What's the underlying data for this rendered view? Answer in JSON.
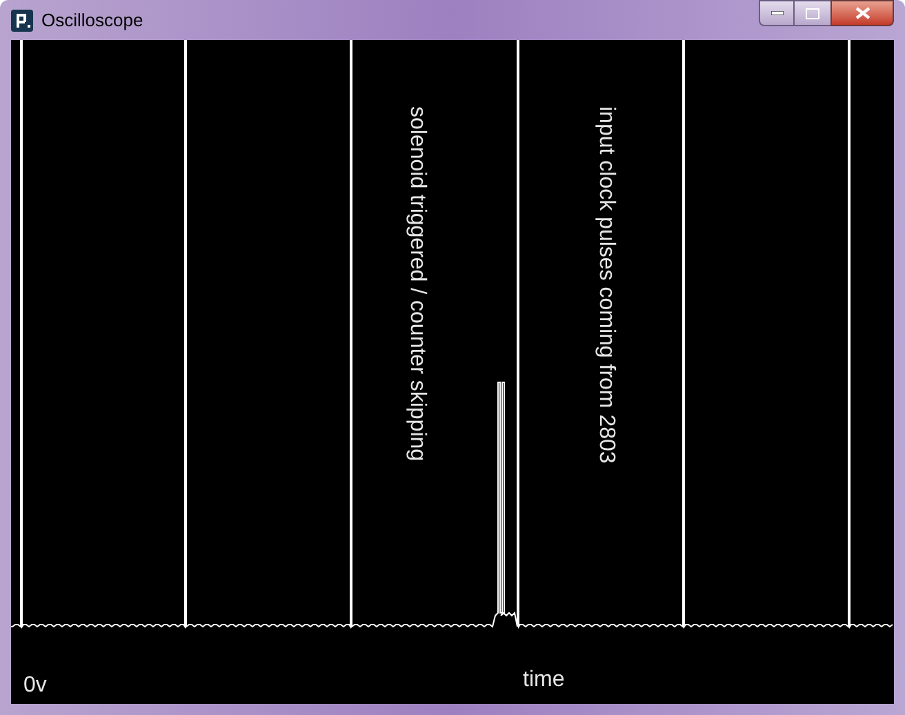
{
  "window": {
    "title": "Oscilloscope"
  },
  "annotations": [
    {
      "text": "solenoid triggered / counter skipping"
    },
    {
      "text": "input clock pulses coming from 2803"
    }
  ],
  "axis_labels": {
    "y": "0v",
    "x": "time"
  }
}
